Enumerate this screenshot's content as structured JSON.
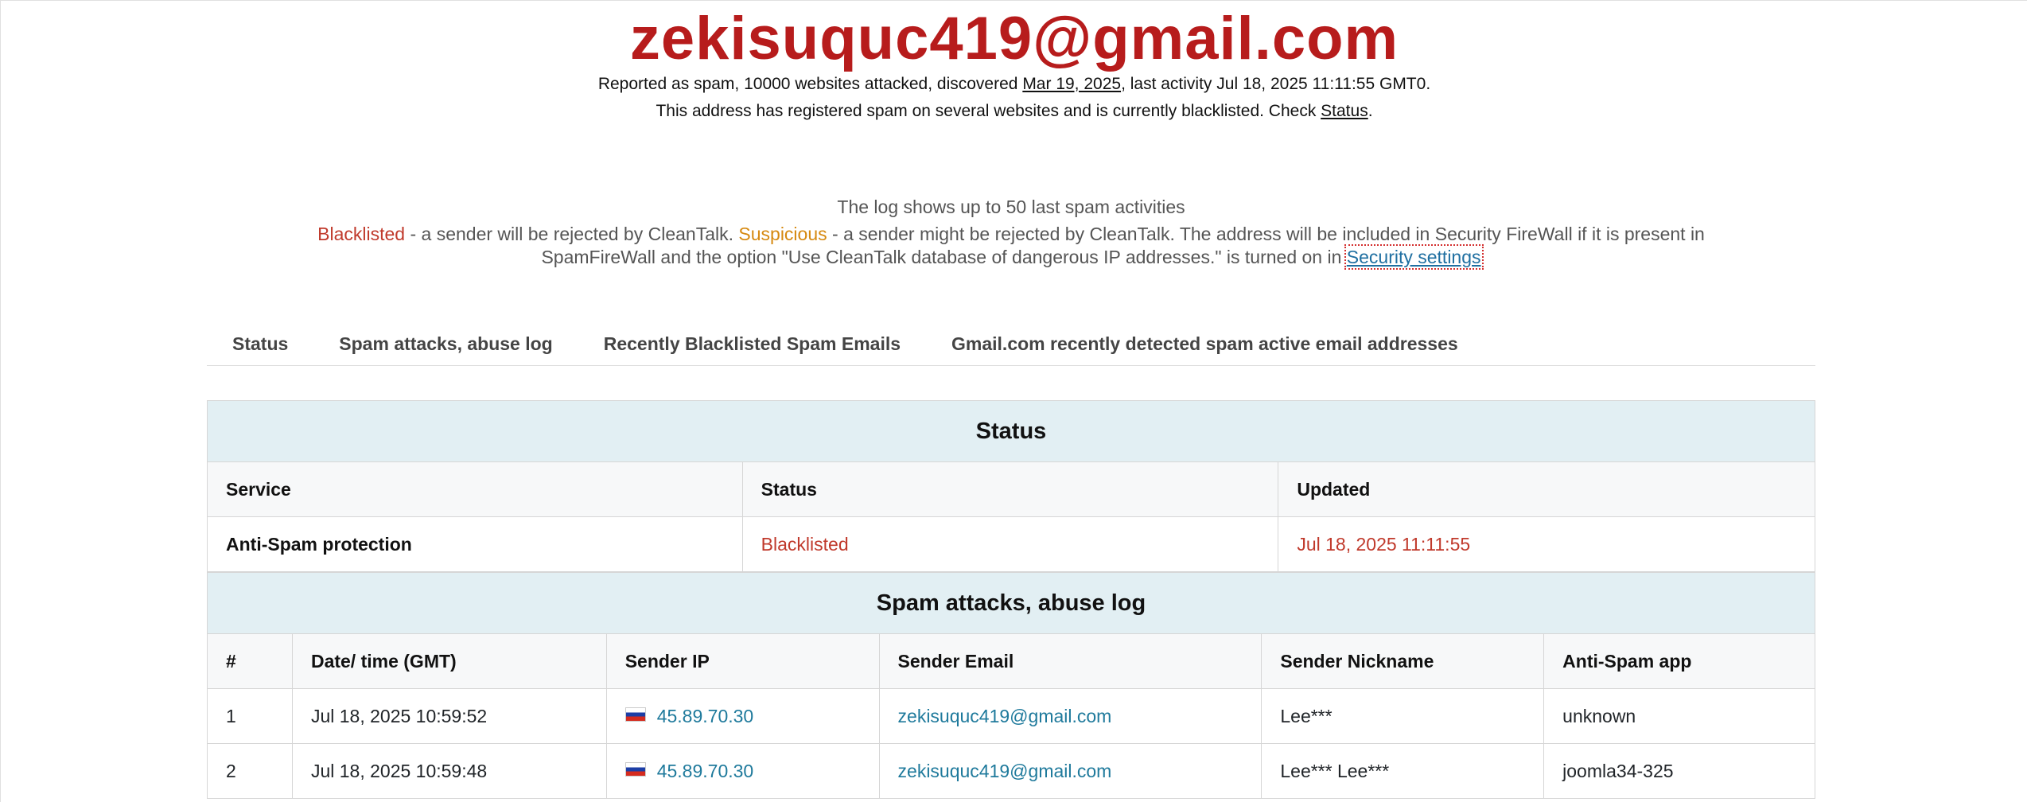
{
  "header": {
    "title": "zekisuquc419@gmail.com",
    "line1_prefix": "Reported as spam, 10000 websites attacked, discovered ",
    "line1_discovered": "Mar 19, 2025",
    "line1_suffix": ", last activity Jul 18, 2025 11:11:55 GMT0.",
    "line2_prefix": "This address has registered spam on several websites and is currently blacklisted. Check ",
    "line2_link": "Status",
    "line2_suffix": "."
  },
  "legend": {
    "log_note": "The log shows up to 50 last spam activities",
    "blacklisted": "Blacklisted",
    "blacklisted_desc": " - a sender will be rejected by CleanTalk. ",
    "suspicious": "Suspicious",
    "suspicious_desc": " - a sender might be rejected by CleanTalk. The address will be included in Security FireWall if it is present in",
    "line3_text": "SpamFireWall and the option \"Use CleanTalk database of dangerous IP addresses.\" is turned on in ",
    "security_link": "Security settings",
    "colors": {
      "blacklisted": "#c0392b",
      "suspicious": "#d68910"
    }
  },
  "tabs": [
    {
      "label": "Status"
    },
    {
      "label": "Spam attacks, abuse log"
    },
    {
      "label": "Recently Blacklisted Spam Emails"
    },
    {
      "label": "Gmail.com recently detected spam active email addresses"
    }
  ],
  "status_section": {
    "heading": "Status",
    "columns": [
      "Service",
      "Status",
      "Updated"
    ],
    "rows": [
      {
        "service": "Anti-Spam protection",
        "status": "Blacklisted",
        "updated": "Jul 18, 2025 11:11:55"
      }
    ]
  },
  "log_section": {
    "heading": "Spam attacks, abuse log",
    "columns": [
      "#",
      "Date/ time (GMT)",
      "Sender IP",
      "Sender Email",
      "Sender Nickname",
      "Anti-Spam app"
    ],
    "rows": [
      {
        "num": "1",
        "datetime": "Jul 18, 2025 10:59:52",
        "flag": "russia-flag-icon",
        "ip": "45.89.70.30",
        "email": "zekisuquc419@gmail.com",
        "nickname": "Lee***",
        "app": "unknown"
      },
      {
        "num": "2",
        "datetime": "Jul 18, 2025 10:59:48",
        "flag": "russia-flag-icon",
        "ip": "45.89.70.30",
        "email": "zekisuquc419@gmail.com",
        "nickname": "Lee*** Lee***",
        "app": "joomla34-325"
      }
    ]
  }
}
